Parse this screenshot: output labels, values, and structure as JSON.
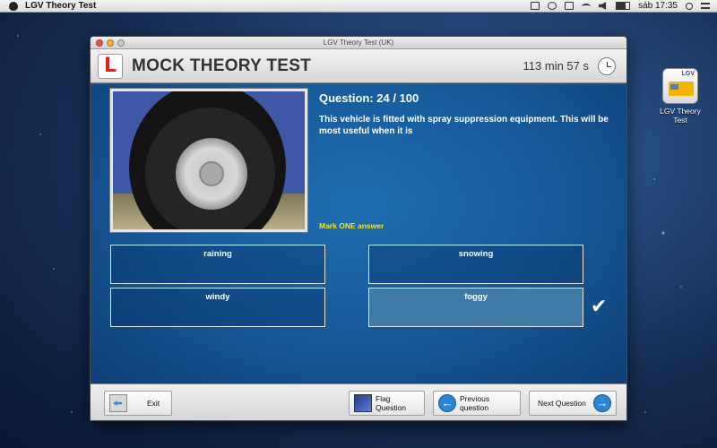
{
  "menubar": {
    "app_name": "LGV Theory Test",
    "clock": "sáb 17:35"
  },
  "desktop": {
    "icon_label": "LGV Theory Test",
    "icon_badge": "LGV"
  },
  "window": {
    "title": "LGV Theory Test (UK)"
  },
  "header": {
    "plate_letter": "L",
    "title": "MOCK THEORY TEST",
    "timer": "113 min 57 s"
  },
  "question": {
    "number": "Question: 24 / 100",
    "text": "This vehicle is fitted with spray suppression equipment. This will be most useful when it is",
    "instruction": "Mark ONE answer",
    "selected_answer": "foggy",
    "answers": [
      "raining",
      "snowing",
      "windy",
      "foggy"
    ]
  },
  "footer": {
    "exit": "Exit",
    "flag": "Flag Question",
    "previous": "Previous question",
    "next": "Next Question"
  },
  "icons": {
    "apple": "apple-icon",
    "clock": "clock-icon",
    "check": "checkmark-icon",
    "arrow_left": "←",
    "arrow_right": "→",
    "check_glyph": "✔"
  },
  "colors": {
    "content_bg": "#1a5490",
    "question_yellow": "#f3e61a",
    "l_plate_red": "#e32216"
  }
}
